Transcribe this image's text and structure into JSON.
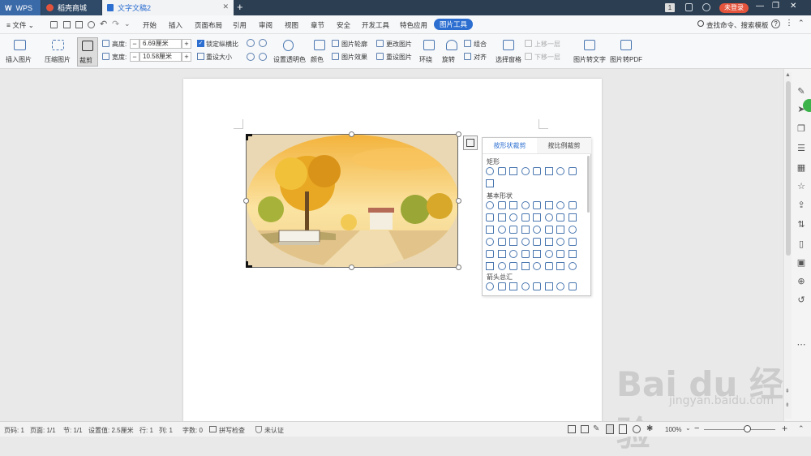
{
  "titlebar": {
    "tabs": [
      {
        "label": "WPS"
      },
      {
        "label": "稻壳商城"
      },
      {
        "label": "文字文稿2"
      }
    ],
    "new_tab": "+",
    "badge": "1",
    "login_label": "未登录",
    "min": "—",
    "max": "❐",
    "close": "✕"
  },
  "menubar": {
    "file_label": "文件",
    "items": [
      "开始",
      "插入",
      "页面布局",
      "引用",
      "审阅",
      "视图",
      "章节",
      "安全",
      "开发工具",
      "特色应用",
      "图片工具"
    ],
    "search_label": "查找命令、搜索模板",
    "help": "?",
    "more": "⋮"
  },
  "ribbon": {
    "insert_picture": "插入图片",
    "compress_picture": "压缩图片",
    "crop": "裁剪",
    "height_label": "高度:",
    "height_value": "6.69厘米",
    "width_label": "宽度:",
    "width_value": "10.58厘米",
    "lock_ratio": "锁定纵横比",
    "reset_size": "重设大小",
    "set_transparent": "设置透明色",
    "color": "颜色",
    "picture_outline": "图片轮廓",
    "picture_effect": "图片效果",
    "change_picture": "更改图片",
    "reset_picture": "重设图片",
    "wrap": "环绕",
    "rotate": "旋转",
    "group": "组合",
    "align": "对齐",
    "select_pane": "选择窗格",
    "up_layer": "上移一层",
    "down_layer": "下移一层",
    "pic_to_text": "图片转文字",
    "pic_to_pdf": "图片转PDF",
    "minus": "−",
    "plus": "+"
  },
  "shape_panel": {
    "tab_shape": "按形状裁剪",
    "tab_ratio": "按比例裁剪",
    "section_rect": "矩形",
    "section_basic": "基本形状",
    "section_arrows": "箭头总汇"
  },
  "statusbar": {
    "page_num": "页码: 1",
    "pages": "页面: 1/1",
    "section": "节: 1/1",
    "setting": "设置值: 2.5厘米",
    "row": "行: 1",
    "col": "列: 1",
    "word_count": "字数: 0",
    "spell_check": "拼写检查",
    "certify": "未认证",
    "zoom": "100%",
    "zoom_minus": "−",
    "zoom_plus": "+",
    "zoom_level": 0.6
  },
  "watermark": {
    "brand": "Bai du 经验",
    "url": "jingyan.baidu.com"
  },
  "colors": {
    "accent": "#2c6fd1",
    "titlebar": "#2b3e52",
    "login": "#e4543d"
  }
}
